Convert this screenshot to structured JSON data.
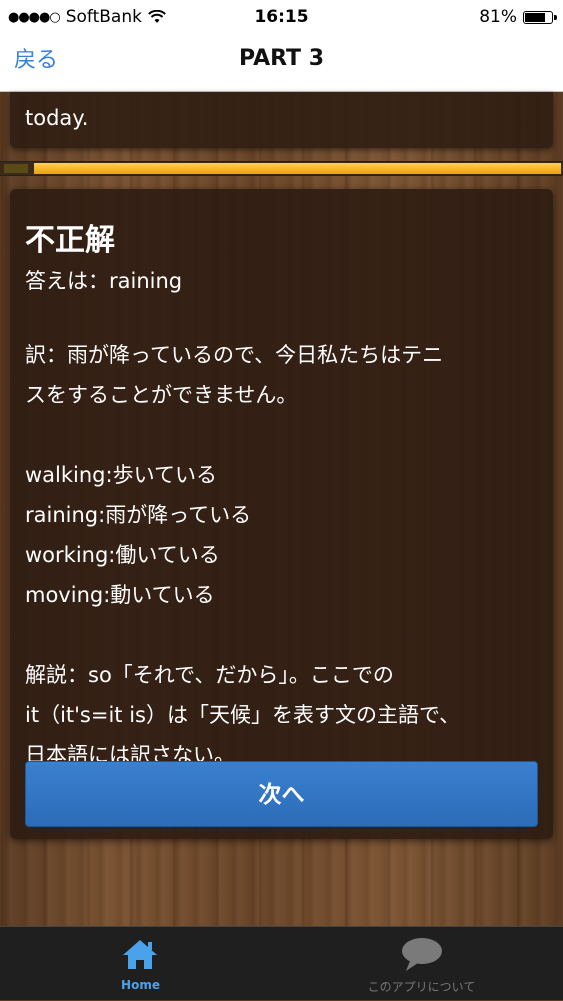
{
  "status_bar": {
    "carrier": "SoftBank",
    "time": "16:15",
    "battery": "81%",
    "battery_level": 0.81
  },
  "nav": {
    "back_label": "戻る",
    "title": "PART 3"
  },
  "previous_card": {
    "text": "today."
  },
  "progress": {
    "value": 0.94
  },
  "result": {
    "heading": "不正解",
    "answer": "答えは：raining",
    "translation_line1": "訳：雨が降っているので、今日私たちはテニ",
    "translation_line2": "スをすることができません。",
    "choices": [
      "walking:歩いている",
      "raining:雨が降っている",
      "working:働いている",
      "moving:動いている"
    ],
    "explanation_line1": "解説：so「それで、だから」。ここでの",
    "explanation_line2": "it（it's=it is）は「天候」を表す文の主語で、",
    "explanation_line3": "日本語には訳さない。",
    "next_label": "次へ"
  },
  "tabbar": {
    "home_label": "Home",
    "about_label": "このアプリについて"
  },
  "colors": {
    "accent_blue": "#3a7fd6",
    "button_blue": "#2f74c4",
    "progress_yellow": "#f2b51c",
    "card_bg": "#2d1c12"
  }
}
